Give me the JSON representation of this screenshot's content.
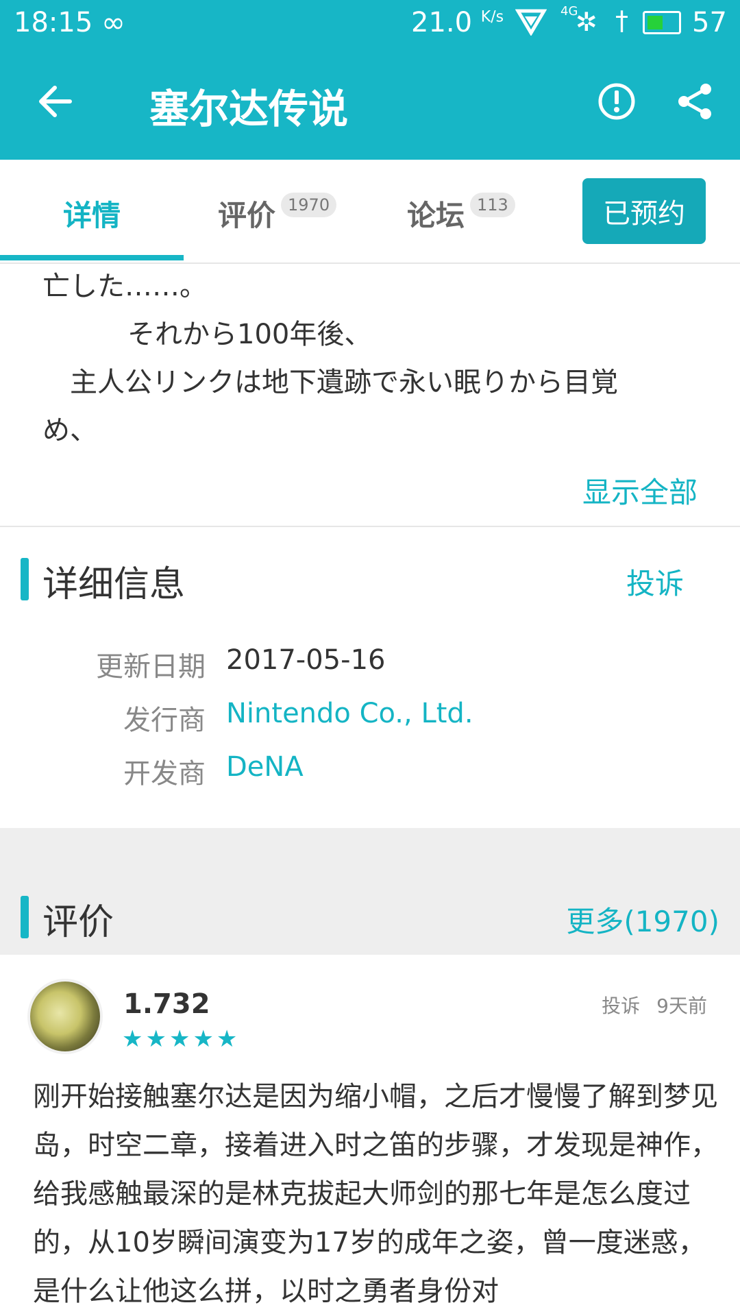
{
  "status_bar": {
    "time": "18:15",
    "infinity": "∞",
    "speed": "21.0",
    "speed_unit": "K/s",
    "signal_label": "4G",
    "battery_level": "57"
  },
  "app_bar": {
    "title": "塞尔达传说",
    "back_icon": "arrow-left-icon",
    "report_icon": "alert-circle-icon",
    "share_icon": "share-icon"
  },
  "tabs": [
    {
      "label": "详情",
      "count": ""
    },
    {
      "label": "评价",
      "count": "1970"
    },
    {
      "label": "论坛",
      "count": "113"
    }
  ],
  "reserve_button": "已预约",
  "description": {
    "lines": [
      "亡した……。",
      "それから100年後、",
      "主人公リンクは地下遺跡で永い眠りから目覚",
      "め、"
    ],
    "show_all": "显示全部"
  },
  "details": {
    "title": "详细信息",
    "report": "投诉",
    "rows": [
      {
        "key": "更新日期",
        "value": "2017-05-16"
      },
      {
        "key": "发行商",
        "value": "Nintendo Co., Ltd."
      },
      {
        "key": "开发商",
        "value": "DeNA"
      }
    ]
  },
  "reviews": {
    "title": "评价",
    "more": "更多(1970)",
    "items": [
      {
        "user": "1.732",
        "rating": 5,
        "stars": "★★★★★",
        "report": "投诉",
        "time": "9天前",
        "text": "刚开始接触塞尔达是因为缩小帽，之后才慢慢了解到梦见岛，时空二章，接着进入时之笛的步骤，才发现是神作，给我感触最深的是林克拔起大师剑的那七年是怎么度过的，从10岁瞬间演变为17岁的成年之姿，曾一度迷惑，是什么让他这么拼，以时之勇者身份对"
      }
    ]
  },
  "colors": {
    "accent": "#17b6c6",
    "button": "#15a9b8",
    "band": "#eeeeee"
  }
}
